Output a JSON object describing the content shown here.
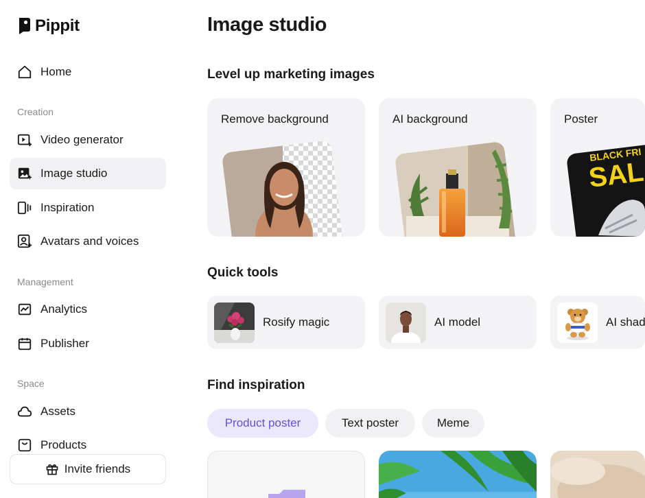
{
  "app": {
    "name": "Pippit"
  },
  "sidebar": {
    "home": {
      "label": "Home",
      "icon": "home-icon"
    },
    "sections": {
      "creation": "Creation",
      "management": "Management",
      "space": "Space"
    },
    "creation_items": [
      {
        "label": "Video generator",
        "icon": "video-plus-icon"
      },
      {
        "label": "Image studio",
        "icon": "image-sparkle-icon",
        "active": true
      },
      {
        "label": "Inspiration",
        "icon": "inspiration-icon"
      },
      {
        "label": "Avatars and voices",
        "icon": "avatar-icon"
      }
    ],
    "management_items": [
      {
        "label": "Analytics",
        "icon": "chart-icon"
      },
      {
        "label": "Publisher",
        "icon": "calendar-icon"
      }
    ],
    "space_items": [
      {
        "label": "Assets",
        "icon": "cloud-icon"
      },
      {
        "label": "Products",
        "icon": "bag-icon"
      }
    ],
    "invite": {
      "label": "Invite friends",
      "icon": "gift-icon"
    }
  },
  "main": {
    "title": "Image studio",
    "marketing": {
      "heading": "Level up marketing images",
      "cards": [
        {
          "label": "Remove background"
        },
        {
          "label": "AI background"
        },
        {
          "label": "Poster",
          "poster_text": "BLACK FRI",
          "poster_big": "SAL"
        }
      ]
    },
    "quick_tools": {
      "heading": "Quick tools",
      "items": [
        {
          "label": "Rosify magic"
        },
        {
          "label": "AI model"
        },
        {
          "label": "AI shad"
        }
      ]
    },
    "inspiration": {
      "heading": "Find inspiration",
      "chips": [
        {
          "label": "Product poster",
          "active": true
        },
        {
          "label": "Text poster"
        },
        {
          "label": "Meme"
        }
      ]
    }
  },
  "colors": {
    "accent": "#6a4fd6",
    "accent_bg": "#ebe8fb",
    "card_bg": "#f3f3f5",
    "muted_text": "#8a8a8f"
  }
}
